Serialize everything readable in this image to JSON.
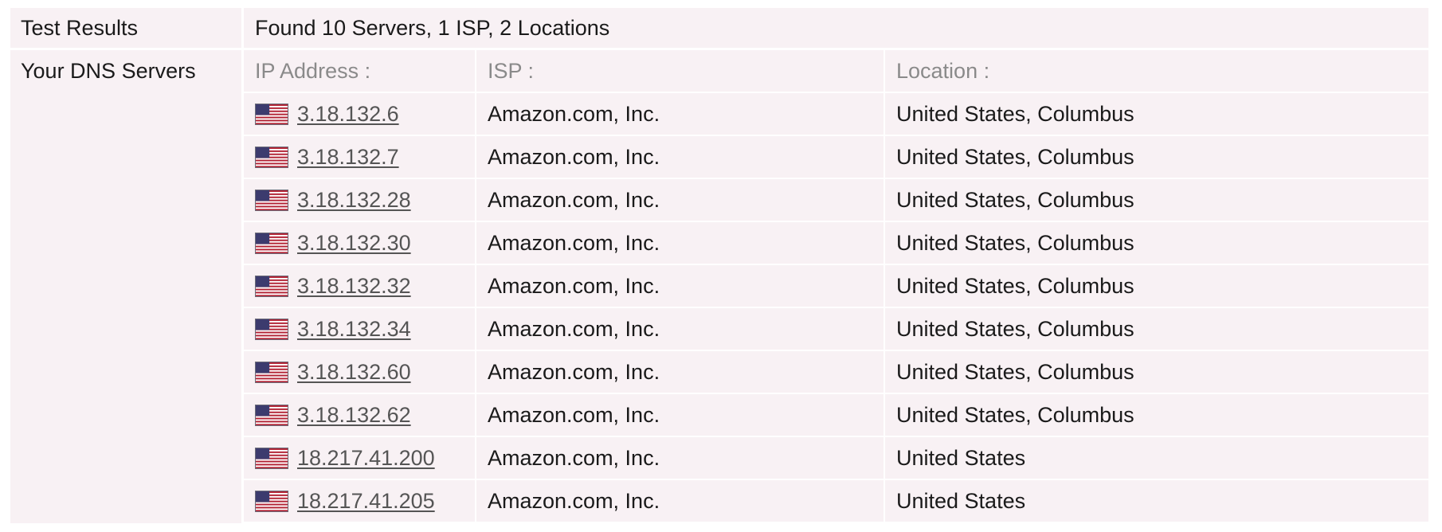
{
  "summary": {
    "label": "Test Results",
    "value": "Found 10 Servers, 1 ISP, 2 Locations"
  },
  "dns": {
    "label": "Your DNS Servers",
    "headers": {
      "ip": "IP Address :",
      "isp": "ISP :",
      "location": "Location :"
    },
    "flag_icon": "us-flag-icon",
    "rows": [
      {
        "ip": "3.18.132.6",
        "isp": "Amazon.com, Inc.",
        "location": "United States, Columbus"
      },
      {
        "ip": "3.18.132.7",
        "isp": "Amazon.com, Inc.",
        "location": "United States, Columbus"
      },
      {
        "ip": "3.18.132.28",
        "isp": "Amazon.com, Inc.",
        "location": "United States, Columbus"
      },
      {
        "ip": "3.18.132.30",
        "isp": "Amazon.com, Inc.",
        "location": "United States, Columbus"
      },
      {
        "ip": "3.18.132.32",
        "isp": "Amazon.com, Inc.",
        "location": "United States, Columbus"
      },
      {
        "ip": "3.18.132.34",
        "isp": "Amazon.com, Inc.",
        "location": "United States, Columbus"
      },
      {
        "ip": "3.18.132.60",
        "isp": "Amazon.com, Inc.",
        "location": "United States, Columbus"
      },
      {
        "ip": "3.18.132.62",
        "isp": "Amazon.com, Inc.",
        "location": "United States, Columbus"
      },
      {
        "ip": "18.217.41.200",
        "isp": "Amazon.com, Inc.",
        "location": "United States"
      },
      {
        "ip": "18.217.41.205",
        "isp": "Amazon.com, Inc.",
        "location": "United States"
      }
    ]
  },
  "colors": {
    "cell_background": "#f8f1f4",
    "header_text": "#8a8a8a",
    "link_text": "#555555",
    "body_text": "#1a1a1a"
  }
}
